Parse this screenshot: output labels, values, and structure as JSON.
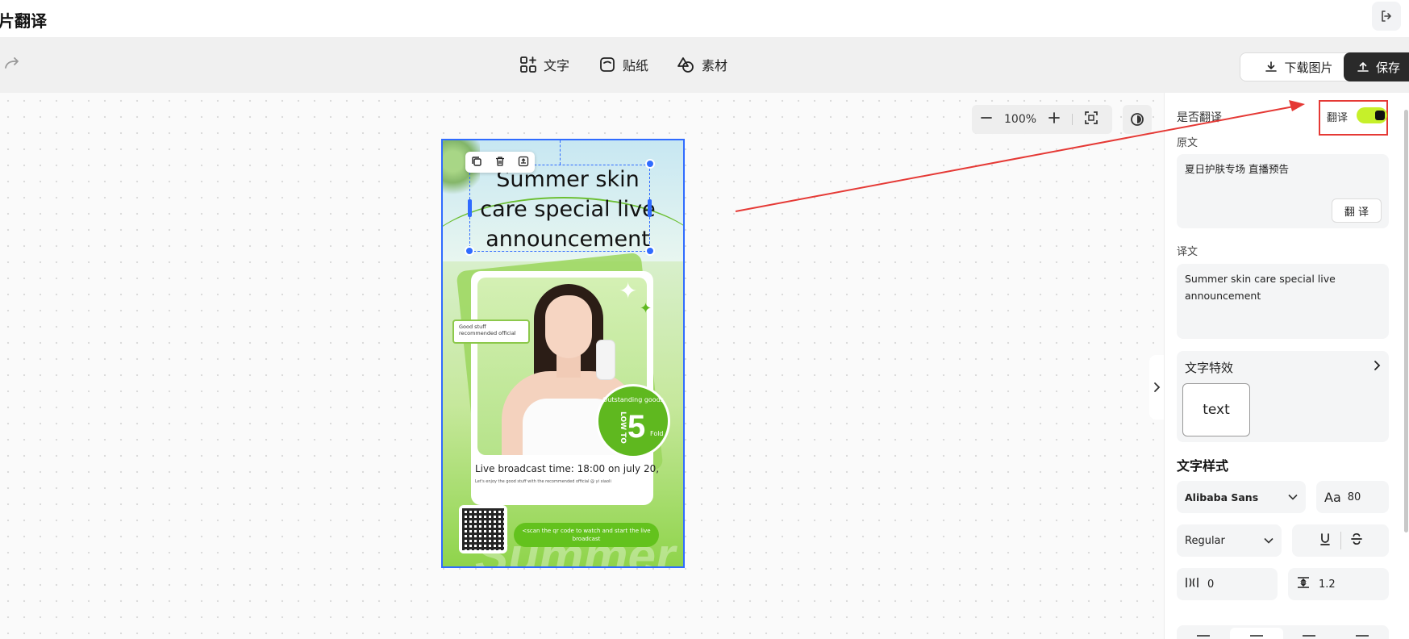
{
  "app": {
    "title": "片翻译"
  },
  "toolbar": {
    "tools": {
      "text": "文字",
      "sticker": "贴纸",
      "material": "素材"
    },
    "download_label": "下载图片",
    "save_label": "保存"
  },
  "zoom": {
    "level": "100%"
  },
  "poster": {
    "headline": "Summer skin care special live announcement",
    "good_tag": "Good stuff recommended official",
    "badge_top": "Outstanding goods",
    "badge_low": "LOW TO",
    "badge_number": "5",
    "badge_fold": "Fold",
    "live_time": "Live broadcast time: 18:00 on july 20,",
    "live_sub": "Let's enjoy the good stuff with the recommended official @ yi xiaoli",
    "cta": "<scan the qr code to watch and start the live broadcast",
    "watermark": "Summer"
  },
  "panel": {
    "is_translate_label": "是否翻译",
    "toggle_label": "翻译",
    "toggle_on": true,
    "source_label": "原文",
    "source_text": "夏日护肤专场 直播预告",
    "translate_button": "翻 译",
    "target_label": "译文",
    "target_text": "Summer skin care special live announcement",
    "effects_title": "文字特效",
    "effect_tile": "text",
    "style_title": "文字样式",
    "font_family": "Alibaba Sans",
    "font_size": "80",
    "font_weight": "Regular",
    "letter_spacing": "0",
    "line_height": "1.2"
  },
  "colors": {
    "accent_blue": "#2f6bff",
    "toggle_green": "#c6f02a",
    "annotation_red": "#e53935",
    "save_dark": "#2a2a2a"
  }
}
